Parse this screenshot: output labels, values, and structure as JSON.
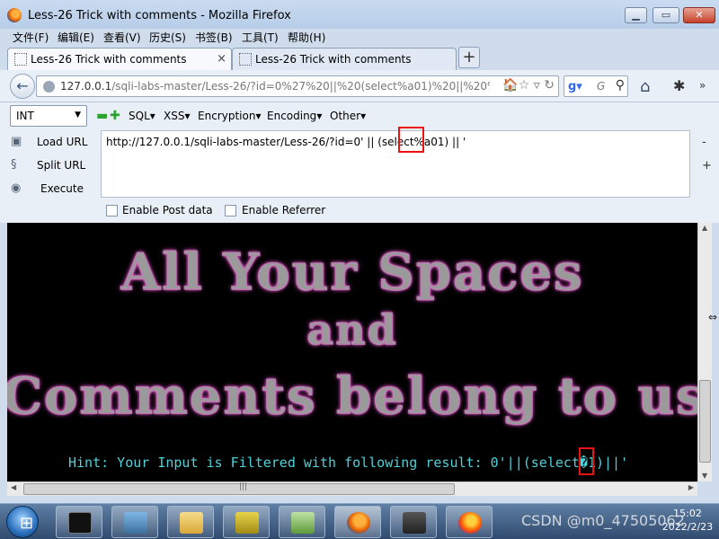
{
  "window": {
    "title": "Less-26 Trick with comments - Mozilla Firefox"
  },
  "menu": [
    "文件(F)",
    "编辑(E)",
    "查看(V)",
    "历史(S)",
    "书签(B)",
    "工具(T)",
    "帮助(H)"
  ],
  "tabs": [
    {
      "label": "Less-26 Trick with comments",
      "active": true
    },
    {
      "label": "Less-26 Trick with comments",
      "active": false
    }
  ],
  "address": {
    "url_host": "127.0.0.1",
    "url_rest": "/sqli-labs-master/Less-26/?id=0%27%20||%20(select%a01)%20||%20%27",
    "search_placeholder": "G"
  },
  "hackbar": {
    "type_select": "INT",
    "menus": [
      "SQL",
      "XSS",
      "Encryption",
      "Encoding",
      "Other"
    ],
    "load_url": "Load URL",
    "split_url": "Split URL",
    "execute": "Execute",
    "url_value": "http://127.0.0.1/sqli-labs-master/Less-26/?id=0' || (select%a01) || '",
    "enable_post": "Enable Post data",
    "enable_referrer": "Enable Referrer"
  },
  "page": {
    "banner_line1": "All Your Spaces",
    "banner_line2": "and",
    "banner_line3": "Comments belong to us",
    "hint": "Hint: Your Input is Filtered with following result: 0'||(select�1)||'"
  },
  "taskbar": {
    "clock_time": "15:02",
    "clock_date": "2022/2/23"
  },
  "watermark": "CSDN @m0_47505062",
  "colors": {
    "hint": "#4fd1d9",
    "highlight_box": "#ee1111",
    "banner_glow": "#ff6ad5"
  }
}
